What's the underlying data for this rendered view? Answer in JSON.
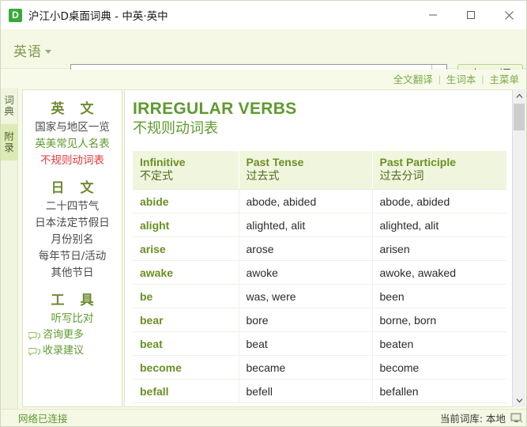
{
  "window": {
    "app_icon_letter": "D",
    "title": "沪江小D桌面词典 - 中英·英中",
    "controls": {
      "minimize": "minimize-button",
      "maximize": "maximize-button",
      "close": "close-button"
    }
  },
  "toolbar": {
    "language_label": "英语",
    "search_value": "",
    "search_placeholder": "",
    "search_button_label": "查 词"
  },
  "links": {
    "items": [
      {
        "label": "全文翻译"
      },
      {
        "label": "生词本"
      },
      {
        "label": "主菜单"
      }
    ],
    "separator": "|"
  },
  "vertical_tabs": [
    {
      "label": "词典",
      "chars": [
        "词",
        "典"
      ],
      "active": false
    },
    {
      "label": "附录",
      "chars": [
        "附",
        "录"
      ],
      "active": true
    }
  ],
  "sidebar": {
    "sections": [
      {
        "heading": "英 文",
        "items": [
          {
            "label": "国家与地区一览",
            "style": "plain"
          },
          {
            "label": "英美常见人名表",
            "style": "green"
          },
          {
            "label": "不规则动词表",
            "style": "red"
          }
        ]
      },
      {
        "heading": "日 文",
        "items": [
          {
            "label": "二十四节气",
            "style": "plain"
          },
          {
            "label": "日本法定节假日",
            "style": "plain"
          },
          {
            "label": "月份别名",
            "style": "plain"
          },
          {
            "label": "每年节日/活动",
            "style": "plain"
          },
          {
            "label": "其他节日",
            "style": "plain"
          }
        ]
      },
      {
        "heading": "工 具",
        "items": [
          {
            "label": "听写比对",
            "style": "green"
          }
        ]
      }
    ],
    "chat_links": [
      {
        "label": "咨询更多",
        "icon": "speech-bubble-icon"
      },
      {
        "label": "收录建议",
        "icon": "speech-bubble-icon"
      }
    ]
  },
  "document": {
    "title_en": "IRREGULAR VERBS",
    "title_cn": "不规则动词表",
    "table": {
      "headers": [
        {
          "en": "Infinitive",
          "cn": "不定式"
        },
        {
          "en": "Past Tense",
          "cn": "过去式"
        },
        {
          "en": "Past Participle",
          "cn": "过去分词"
        }
      ],
      "rows": [
        [
          "abide",
          "abode, abided",
          "abode, abided"
        ],
        [
          "alight",
          "alighted, alit",
          "alighted, alit"
        ],
        [
          "arise",
          "arose",
          "arisen"
        ],
        [
          "awake",
          "awoke",
          "awoke, awaked"
        ],
        [
          "be",
          "was, were",
          "been"
        ],
        [
          "bear",
          "bore",
          "borne, born"
        ],
        [
          "beat",
          "beat",
          "beaten"
        ],
        [
          "become",
          "became",
          "become"
        ],
        [
          "befall",
          "befell",
          "befallen"
        ]
      ]
    }
  },
  "scrollbar": {
    "up_arrow": "scroll-up-arrow",
    "down_arrow": "scroll-down-arrow"
  },
  "statusbar": {
    "network_status": "网络已连接",
    "dictionary_label": "当前词库: 本地",
    "icon": "monitor-icon"
  },
  "colors": {
    "accent_green": "#5d9a2e",
    "heading_green": "#6f8b35",
    "selected_red": "#e03a3a",
    "toolbar_bg": "#f4f8e4",
    "app_icon": "#3aa93a"
  }
}
